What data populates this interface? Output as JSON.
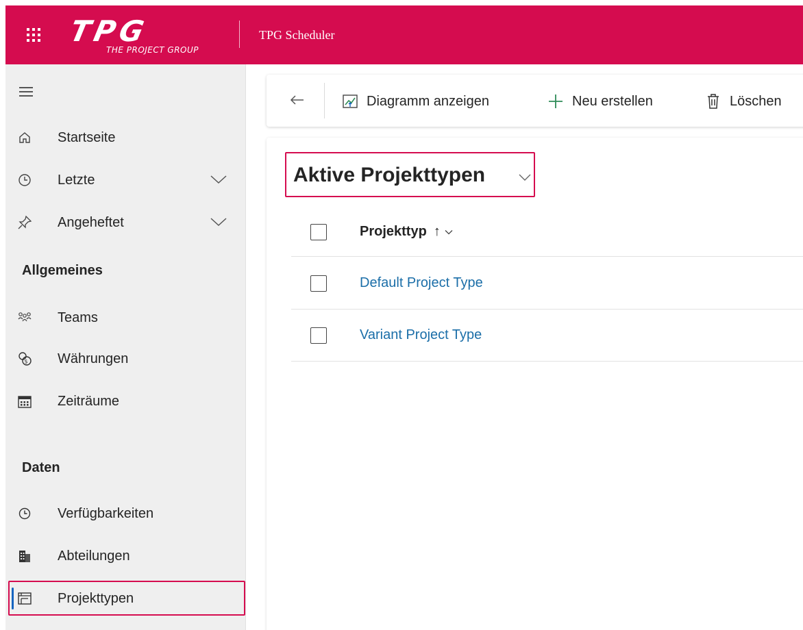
{
  "header": {
    "logo_text": "TPG",
    "logo_subtitle": "THE PROJECT GROUP",
    "app_name": "TPG Scheduler",
    "brand_color": "#D50C4F"
  },
  "sidebar": {
    "items_top": [
      {
        "label": "Startseite",
        "icon": "home-icon"
      },
      {
        "label": "Letzte",
        "icon": "clock-icon"
      },
      {
        "label": "Angeheftet",
        "icon": "pin-icon"
      }
    ],
    "section_general": "Allgemeines",
    "items_general": [
      {
        "label": "Teams",
        "icon": "teams-icon"
      },
      {
        "label": "Währungen",
        "icon": "currency-icon"
      },
      {
        "label": "Zeiträume",
        "icon": "calendar-icon"
      }
    ],
    "section_data": "Daten",
    "items_data": [
      {
        "label": "Verfügbarkeiten",
        "icon": "availability-icon"
      },
      {
        "label": "Abteilungen",
        "icon": "building-icon"
      },
      {
        "label": "Projekttypen",
        "icon": "project-type-icon"
      }
    ]
  },
  "commandbar": {
    "show_chart": "Diagramm anzeigen",
    "new": "Neu erstellen",
    "delete": "Löschen"
  },
  "view": {
    "title": "Aktive Projekttypen",
    "column_header": "Projekttyp",
    "sort_indicator": "↑",
    "rows": [
      "Default Project Type",
      "Variant Project Type"
    ]
  }
}
